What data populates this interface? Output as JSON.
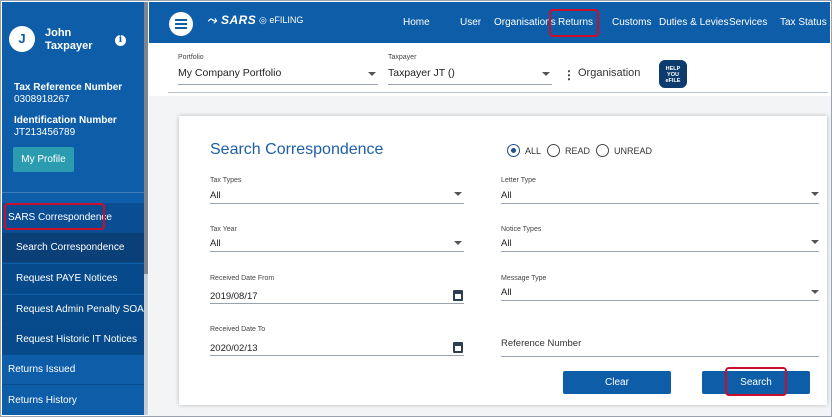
{
  "user": {
    "initial": "J",
    "name": "John Taxpayer"
  },
  "sidebar": {
    "tax_ref_label": "Tax Reference Number",
    "tax_ref_value": "0308918267",
    "id_label": "Identification Number",
    "id_value": "JT213456789",
    "profile_button": "My Profile",
    "items": [
      {
        "label": "SARS Correspondence"
      },
      {
        "label": "Search Correspondence"
      },
      {
        "label": "Request PAYE Notices"
      },
      {
        "label": "Request Admin Penalty SOA"
      },
      {
        "label": "Request Historic IT Notices"
      },
      {
        "label": "Returns Issued"
      },
      {
        "label": "Returns History"
      }
    ]
  },
  "topbar": {
    "logo": "SARS",
    "efiling": "eFILING",
    "links": [
      "Home",
      "User",
      "Organisations",
      "Returns",
      "Customs",
      "Duties & Levies",
      "Services",
      "Tax Status"
    ]
  },
  "portfolio": {
    "portfolio_label": "Portfolio",
    "portfolio_value": "My Company Portfolio",
    "taxpayer_label": "Taxpayer",
    "taxpayer_value": "Taxpayer JT ()",
    "org_label": "Organisation",
    "help_text": "HELP YOU eFILE"
  },
  "search": {
    "title": "Search Correspondence",
    "radio_all": "ALL",
    "radio_read": "READ",
    "radio_unread": "UNREAD",
    "tax_types_label": "Tax Types",
    "tax_types_value": "All",
    "letter_type_label": "Letter Type",
    "letter_type_value": "All",
    "tax_year_label": "Tax Year",
    "tax_year_value": "All",
    "notice_types_label": "Notice Types",
    "notice_types_value": "All",
    "date_from_label": "Received Date From",
    "date_from_value": "2019/08/17",
    "message_type_label": "Message Type",
    "message_type_value": "All",
    "date_to_label": "Received Date To",
    "date_to_value": "2020/02/13",
    "reference_label": "Reference Number",
    "clear_button": "Clear",
    "search_button": "Search"
  }
}
